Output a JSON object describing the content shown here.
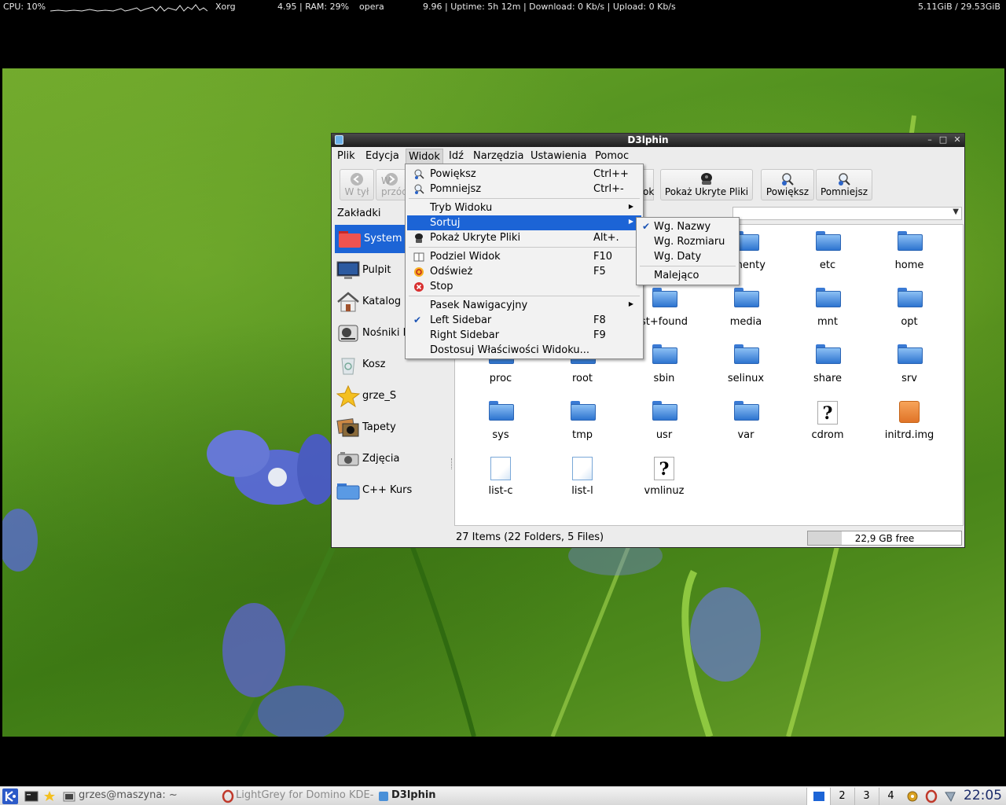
{
  "conky": {
    "cpu": "CPU: 10%",
    "proc1": "Xorg",
    "load_ram": "4.95 | RAM: 29%",
    "proc2": "opera",
    "stats": "9.96  |  Uptime: 5h 12m  |  Download: 0 Kb/s | Upload: 0 Kb/s",
    "disk": "5.11GiB / 29.53GiB"
  },
  "window": {
    "title": "D3lphin",
    "controls": {
      "minimize": "–",
      "maximize": "□",
      "close": "✕"
    }
  },
  "menubar": {
    "items": [
      "Plik",
      "Edycja",
      "Widok",
      "Idź",
      "Narzędzia",
      "Ustawienia",
      "Pomoc"
    ]
  },
  "toolbar": {
    "back": "W tył",
    "forward": "W przód",
    "partial": "ok",
    "show_hidden": "Pokaż Ukryte Pliki",
    "zoom_in": "Powiększ",
    "zoom_out": "Pomniejsz"
  },
  "bookmarks": {
    "header": "Zakładki",
    "items": [
      "System Plików",
      "Pulpit",
      "Katalog Domowy",
      "Nośniki Danych",
      "Kosz",
      "grze_S",
      "Tapety",
      "Zdjęcia",
      "C++ Kurs"
    ]
  },
  "files": [
    {
      "name": "umenty",
      "type": "folder"
    },
    {
      "name": "etc",
      "type": "folder"
    },
    {
      "name": "home",
      "type": "folder"
    },
    {
      "name": "st+found",
      "type": "folder"
    },
    {
      "name": "media",
      "type": "folder"
    },
    {
      "name": "mnt",
      "type": "folder"
    },
    {
      "name": "opt",
      "type": "folder"
    },
    {
      "name": "proc",
      "type": "folder"
    },
    {
      "name": "root",
      "type": "folder"
    },
    {
      "name": "sbin",
      "type": "folder"
    },
    {
      "name": "selinux",
      "type": "folder"
    },
    {
      "name": "share",
      "type": "folder"
    },
    {
      "name": "srv",
      "type": "folder"
    },
    {
      "name": "sys",
      "type": "folder"
    },
    {
      "name": "tmp",
      "type": "folder"
    },
    {
      "name": "usr",
      "type": "folder"
    },
    {
      "name": "var",
      "type": "folder"
    },
    {
      "name": "cdrom",
      "type": "unknown"
    },
    {
      "name": "initrd.img",
      "type": "image"
    },
    {
      "name": "list-c",
      "type": "doc"
    },
    {
      "name": "list-l",
      "type": "doc"
    },
    {
      "name": "vmlinuz",
      "type": "unknown"
    }
  ],
  "status": {
    "text": "27 Items (22 Folders, 5 Files)",
    "free": "22,9 GB free",
    "used_fraction": 0.22
  },
  "widok_menu": {
    "zoom_in": {
      "label": "Powiększ",
      "shortcut": "Ctrl++"
    },
    "zoom_out": {
      "label": "Pomniejsz",
      "shortcut": "Ctrl+-"
    },
    "view_mode": {
      "label": "Tryb Widoku"
    },
    "sort": {
      "label": "Sortuj"
    },
    "show_hidden": {
      "label": "Pokaż Ukryte Pliki",
      "shortcut": "Alt+."
    },
    "split": {
      "label": "Podziel Widok",
      "shortcut": "F10"
    },
    "refresh": {
      "label": "Odśwież",
      "shortcut": "F5"
    },
    "stop": {
      "label": "Stop"
    },
    "navbar": {
      "label": "Pasek Nawigacyjny"
    },
    "left_sidebar": {
      "label": "Left Sidebar",
      "shortcut": "F8"
    },
    "right_sidebar": {
      "label": "Right Sidebar",
      "shortcut": "F9"
    },
    "adjust": {
      "label": "Dostosuj Właściwości Widoku..."
    }
  },
  "sort_menu": {
    "by_name": "Wg. Nazwy",
    "by_size": "Wg. Rozmiaru",
    "by_date": "Wg. Daty",
    "descending": "Malejąco"
  },
  "taskbar": {
    "terminal": "grzes@maszyna: ~",
    "browser": "LightGrey for Domino KDE-L",
    "filemanager": "D3lphin",
    "desktops": [
      "2",
      "3",
      "4"
    ],
    "clock": "22:05"
  },
  "colors": {
    "selection": "#1c64d6",
    "accent_folder": "#3a7ad4"
  }
}
